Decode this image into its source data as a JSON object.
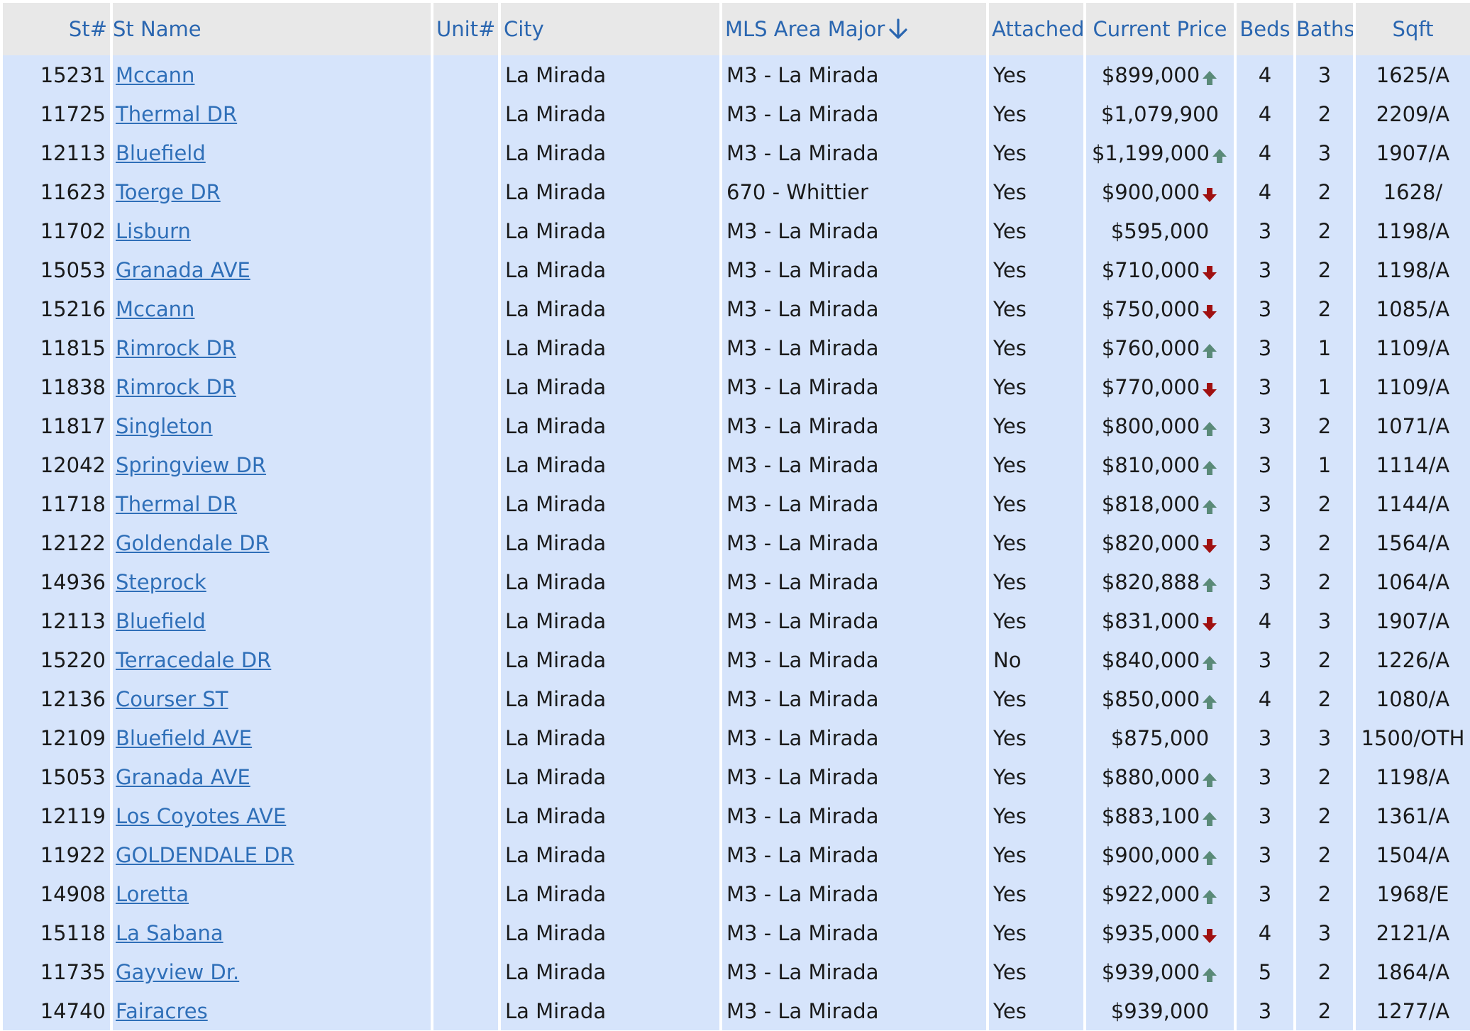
{
  "colors": {
    "header_bg": "#e8e8e8",
    "header_text": "#2a66b0",
    "row_bg": "#d6e4fb",
    "link": "#2f6fb8",
    "arrow_up": "#5a8a78",
    "arrow_down": "#a01010"
  },
  "columns": [
    {
      "key": "st_num",
      "label": "St#"
    },
    {
      "key": "st_name",
      "label": "St Name"
    },
    {
      "key": "unit",
      "label": "Unit#"
    },
    {
      "key": "city",
      "label": "City"
    },
    {
      "key": "area",
      "label": "MLS Area Major",
      "sort_icon": "sort-down-arrow-icon"
    },
    {
      "key": "attached",
      "label": "Attached"
    },
    {
      "key": "price",
      "label": "Current Price"
    },
    {
      "key": "beds",
      "label": "Beds"
    },
    {
      "key": "baths",
      "label": "Baths"
    },
    {
      "key": "sqft",
      "label": "Sqft"
    }
  ],
  "rows": [
    {
      "st_num": "15231",
      "st_name": "Mccann",
      "unit": "",
      "city": "La Mirada",
      "area": "M3 - La Mirada",
      "attached": "Yes",
      "price": "$899,000",
      "trend": "up",
      "beds": "4",
      "baths": "3",
      "sqft": "1625/A"
    },
    {
      "st_num": "11725",
      "st_name": "Thermal DR",
      "unit": "",
      "city": "La Mirada",
      "area": "M3 - La Mirada",
      "attached": "Yes",
      "price": "$1,079,900",
      "trend": "",
      "beds": "4",
      "baths": "2",
      "sqft": "2209/A"
    },
    {
      "st_num": "12113",
      "st_name": "Bluefield",
      "unit": "",
      "city": "La Mirada",
      "area": "M3 - La Mirada",
      "attached": "Yes",
      "price": "$1,199,000",
      "trend": "up",
      "beds": "4",
      "baths": "3",
      "sqft": "1907/A"
    },
    {
      "st_num": "11623",
      "st_name": "Toerge DR",
      "unit": "",
      "city": "La Mirada",
      "area": "670 - Whittier",
      "attached": "Yes",
      "price": "$900,000",
      "trend": "down",
      "beds": "4",
      "baths": "2",
      "sqft": "1628/"
    },
    {
      "st_num": "11702",
      "st_name": "Lisburn",
      "unit": "",
      "city": "La Mirada",
      "area": "M3 - La Mirada",
      "attached": "Yes",
      "price": "$595,000",
      "trend": "",
      "beds": "3",
      "baths": "2",
      "sqft": "1198/A"
    },
    {
      "st_num": "15053",
      "st_name": "Granada AVE",
      "unit": "",
      "city": "La Mirada",
      "area": "M3 - La Mirada",
      "attached": "Yes",
      "price": "$710,000",
      "trend": "down",
      "beds": "3",
      "baths": "2",
      "sqft": "1198/A"
    },
    {
      "st_num": "15216",
      "st_name": "Mccann",
      "unit": "",
      "city": "La Mirada",
      "area": "M3 - La Mirada",
      "attached": "Yes",
      "price": "$750,000",
      "trend": "down",
      "beds": "3",
      "baths": "2",
      "sqft": "1085/A"
    },
    {
      "st_num": "11815",
      "st_name": "Rimrock DR",
      "unit": "",
      "city": "La Mirada",
      "area": "M3 - La Mirada",
      "attached": "Yes",
      "price": "$760,000",
      "trend": "up",
      "beds": "3",
      "baths": "1",
      "sqft": "1109/A"
    },
    {
      "st_num": "11838",
      "st_name": "Rimrock DR",
      "unit": "",
      "city": "La Mirada",
      "area": "M3 - La Mirada",
      "attached": "Yes",
      "price": "$770,000",
      "trend": "down",
      "beds": "3",
      "baths": "1",
      "sqft": "1109/A"
    },
    {
      "st_num": "11817",
      "st_name": "Singleton",
      "unit": "",
      "city": "La Mirada",
      "area": "M3 - La Mirada",
      "attached": "Yes",
      "price": "$800,000",
      "trend": "up",
      "beds": "3",
      "baths": "2",
      "sqft": "1071/A"
    },
    {
      "st_num": "12042",
      "st_name": "Springview DR",
      "unit": "",
      "city": "La Mirada",
      "area": "M3 - La Mirada",
      "attached": "Yes",
      "price": "$810,000",
      "trend": "up",
      "beds": "3",
      "baths": "1",
      "sqft": "1114/A"
    },
    {
      "st_num": "11718",
      "st_name": "Thermal DR",
      "unit": "",
      "city": "La Mirada",
      "area": "M3 - La Mirada",
      "attached": "Yes",
      "price": "$818,000",
      "trend": "up",
      "beds": "3",
      "baths": "2",
      "sqft": "1144/A"
    },
    {
      "st_num": "12122",
      "st_name": "Goldendale DR",
      "unit": "",
      "city": "La Mirada",
      "area": "M3 - La Mirada",
      "attached": "Yes",
      "price": "$820,000",
      "trend": "down",
      "beds": "3",
      "baths": "2",
      "sqft": "1564/A"
    },
    {
      "st_num": "14936",
      "st_name": "Steprock",
      "unit": "",
      "city": "La Mirada",
      "area": "M3 - La Mirada",
      "attached": "Yes",
      "price": "$820,888",
      "trend": "up",
      "beds": "3",
      "baths": "2",
      "sqft": "1064/A"
    },
    {
      "st_num": "12113",
      "st_name": "Bluefield",
      "unit": "",
      "city": "La Mirada",
      "area": "M3 - La Mirada",
      "attached": "Yes",
      "price": "$831,000",
      "trend": "down",
      "beds": "4",
      "baths": "3",
      "sqft": "1907/A"
    },
    {
      "st_num": "15220",
      "st_name": "Terracedale DR",
      "unit": "",
      "city": "La Mirada",
      "area": "M3 - La Mirada",
      "attached": "No",
      "price": "$840,000",
      "trend": "up",
      "beds": "3",
      "baths": "2",
      "sqft": "1226/A"
    },
    {
      "st_num": "12136",
      "st_name": "Courser ST",
      "unit": "",
      "city": "La Mirada",
      "area": "M3 - La Mirada",
      "attached": "Yes",
      "price": "$850,000",
      "trend": "up",
      "beds": "4",
      "baths": "2",
      "sqft": "1080/A"
    },
    {
      "st_num": "12109",
      "st_name": "Bluefield AVE",
      "unit": "",
      "city": "La Mirada",
      "area": "M3 - La Mirada",
      "attached": "Yes",
      "price": "$875,000",
      "trend": "",
      "beds": "3",
      "baths": "3",
      "sqft": "1500/OTH"
    },
    {
      "st_num": "15053",
      "st_name": "Granada AVE",
      "unit": "",
      "city": "La Mirada",
      "area": "M3 - La Mirada",
      "attached": "Yes",
      "price": "$880,000",
      "trend": "up",
      "beds": "3",
      "baths": "2",
      "sqft": "1198/A"
    },
    {
      "st_num": "12119",
      "st_name": "Los Coyotes AVE",
      "unit": "",
      "city": "La Mirada",
      "area": "M3 - La Mirada",
      "attached": "Yes",
      "price": "$883,100",
      "trend": "up",
      "beds": "3",
      "baths": "2",
      "sqft": "1361/A"
    },
    {
      "st_num": "11922",
      "st_name": "GOLDENDALE DR",
      "unit": "",
      "city": "La Mirada",
      "area": "M3 - La Mirada",
      "attached": "Yes",
      "price": "$900,000",
      "trend": "up",
      "beds": "3",
      "baths": "2",
      "sqft": "1504/A"
    },
    {
      "st_num": "14908",
      "st_name": "Loretta",
      "unit": "",
      "city": "La Mirada",
      "area": "M3 - La Mirada",
      "attached": "Yes",
      "price": "$922,000",
      "trend": "up",
      "beds": "3",
      "baths": "2",
      "sqft": "1968/E"
    },
    {
      "st_num": "15118",
      "st_name": "La Sabana",
      "unit": "",
      "city": "La Mirada",
      "area": "M3 - La Mirada",
      "attached": "Yes",
      "price": "$935,000",
      "trend": "down",
      "beds": "4",
      "baths": "3",
      "sqft": "2121/A"
    },
    {
      "st_num": "11735",
      "st_name": "Gayview Dr.",
      "unit": "",
      "city": "La Mirada",
      "area": "M3 - La Mirada",
      "attached": "Yes",
      "price": "$939,000",
      "trend": "up",
      "beds": "5",
      "baths": "2",
      "sqft": "1864/A"
    },
    {
      "st_num": "14740",
      "st_name": "Fairacres",
      "unit": "",
      "city": "La Mirada",
      "area": "M3 - La Mirada",
      "attached": "Yes",
      "price": "$939,000",
      "trend": "",
      "beds": "3",
      "baths": "2",
      "sqft": "1277/A"
    }
  ]
}
